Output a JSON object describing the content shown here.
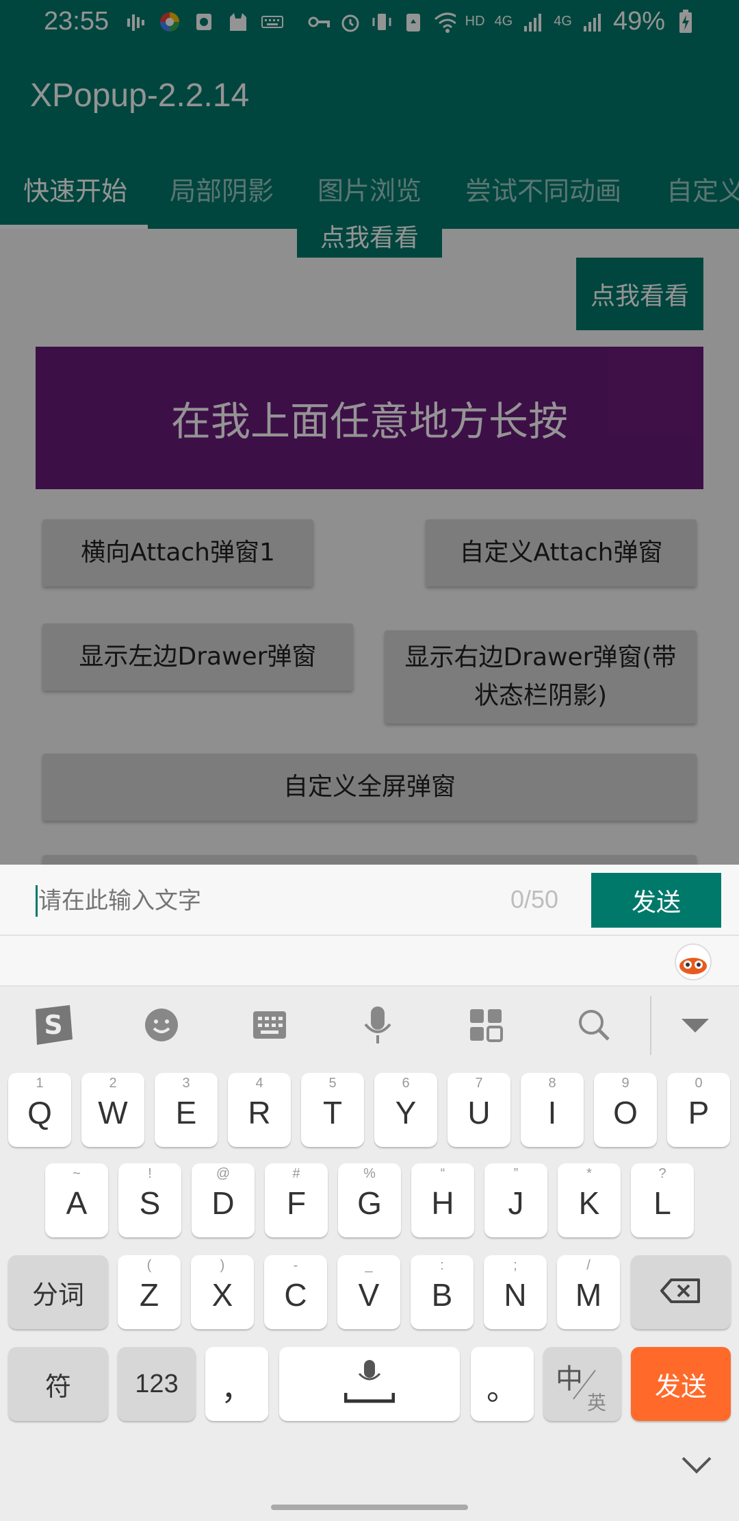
{
  "status_bar": {
    "time": "23:55",
    "network_hd": "HD",
    "net1": "4G",
    "net2": "4G",
    "battery": "49%",
    "icons_left": [
      "signal-wave-icon",
      "color-wheel-icon",
      "screenshot-icon",
      "cat-icon",
      "keyboard-icon"
    ],
    "icons_right": [
      "key-icon",
      "alarm-icon",
      "vibrate-icon",
      "recycle-icon",
      "wifi-icon",
      "signal-icon",
      "battery-charging-icon"
    ]
  },
  "app_bar": {
    "title": "XPopup-2.2.14"
  },
  "tabs": [
    {
      "label": "快速开始",
      "active": true
    },
    {
      "label": "局部阴影",
      "active": false
    },
    {
      "label": "图片浏览",
      "active": false
    },
    {
      "label": "尝试不同动画",
      "active": false
    },
    {
      "label": "自定义",
      "active": false
    }
  ],
  "content": {
    "top_partial_button": "点我看看",
    "look_button": "点我看看",
    "long_press_area": "在我上面任意地方长按",
    "buttons": [
      "横向Attach弹窗1",
      "自定义Attach弹窗",
      "显示左边Drawer弹窗",
      "显示右边Drawer弹窗(带状态栏阴影)",
      "自定义全屏弹窗"
    ]
  },
  "input_bar": {
    "placeholder": "请在此输入文字",
    "counter": "0/50",
    "send_label": "发送"
  },
  "keyboard": {
    "toolbar_icons": [
      "sogou-logo-icon",
      "emoji-icon",
      "keyboard-layout-icon",
      "microphone-icon",
      "apps-grid-icon",
      "search-icon",
      "hide-keyboard-icon"
    ],
    "row1": [
      {
        "k": "Q",
        "s": "1"
      },
      {
        "k": "W",
        "s": "2"
      },
      {
        "k": "E",
        "s": "3"
      },
      {
        "k": "R",
        "s": "4"
      },
      {
        "k": "T",
        "s": "5"
      },
      {
        "k": "Y",
        "s": "6"
      },
      {
        "k": "U",
        "s": "7"
      },
      {
        "k": "I",
        "s": "8"
      },
      {
        "k": "O",
        "s": "9"
      },
      {
        "k": "P",
        "s": "0"
      }
    ],
    "row2": [
      {
        "k": "A",
        "s": "~"
      },
      {
        "k": "S",
        "s": "!"
      },
      {
        "k": "D",
        "s": "@"
      },
      {
        "k": "F",
        "s": "#"
      },
      {
        "k": "G",
        "s": "%"
      },
      {
        "k": "H",
        "s": "“"
      },
      {
        "k": "J",
        "s": "”"
      },
      {
        "k": "K",
        "s": "*"
      },
      {
        "k": "L",
        "s": "?"
      }
    ],
    "row3": [
      {
        "k": "Z",
        "s": "("
      },
      {
        "k": "X",
        "s": ")"
      },
      {
        "k": "C",
        "s": "-"
      },
      {
        "k": "V",
        "s": "_"
      },
      {
        "k": "B",
        "s": ":"
      },
      {
        "k": "N",
        "s": ";"
      },
      {
        "k": "M",
        "s": "/"
      }
    ],
    "segment_key": "分词",
    "symbol_key": "符",
    "number_key": "123",
    "comma_key": "，",
    "period_key": "。",
    "lang_key_main": "中",
    "lang_key_sub": "英",
    "send_key": "发送"
  }
}
